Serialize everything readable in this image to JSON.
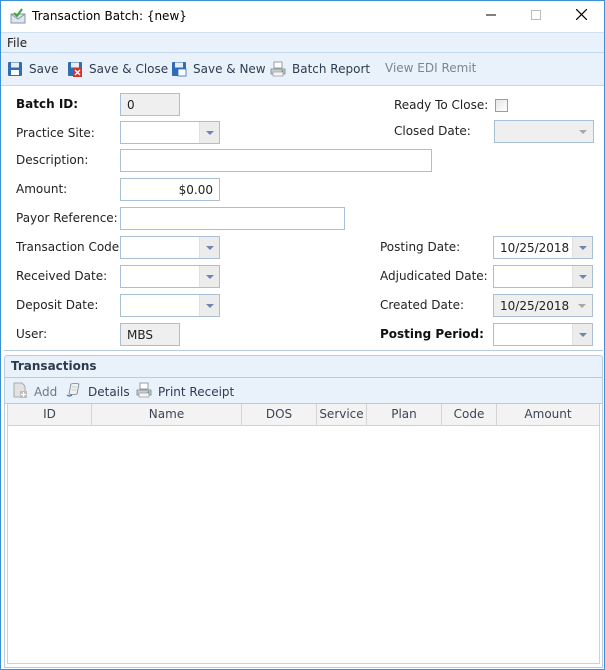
{
  "window": {
    "title": "Transaction Batch: {new}",
    "icon": "envelope-check-icon",
    "controls": {
      "minimize": "minimize-icon",
      "maximize": "maximize-icon",
      "close": "close-icon"
    }
  },
  "menu": {
    "items": [
      {
        "label": "File"
      }
    ]
  },
  "toolbar": {
    "buttons": [
      {
        "label": "Save",
        "icon": "save-icon",
        "enabled": true
      },
      {
        "label": "Save & Close",
        "icon": "save-close-icon",
        "enabled": true
      },
      {
        "label": "Save & New",
        "icon": "save-new-icon",
        "enabled": true
      },
      {
        "label": "Batch Report",
        "icon": "printer-icon",
        "enabled": true
      },
      {
        "label": "View EDI Remit",
        "icon": "",
        "enabled": false
      }
    ]
  },
  "form": {
    "batch_id": {
      "label": "Batch ID:",
      "value": "0"
    },
    "practice_site": {
      "label": "Practice Site:",
      "value": ""
    },
    "description": {
      "label": "Description:",
      "value": ""
    },
    "amount": {
      "label": "Amount:",
      "value": "$0.00"
    },
    "payor_reference": {
      "label": "Payor Reference:",
      "value": ""
    },
    "transaction_code": {
      "label": "Transaction Code:",
      "value": ""
    },
    "received_date": {
      "label": "Received Date:",
      "value": ""
    },
    "deposit_date": {
      "label": "Deposit Date:",
      "value": ""
    },
    "user": {
      "label": "User:",
      "value": "MBS"
    },
    "ready_to_close": {
      "label": "Ready To Close:",
      "checked": false
    },
    "closed_date": {
      "label": "Closed Date:",
      "value": ""
    },
    "posting_date": {
      "label": "Posting Date:",
      "value": "10/25/2018"
    },
    "adjudicated_date": {
      "label": "Adjudicated Date:",
      "value": ""
    },
    "created_date": {
      "label": "Created Date:",
      "value": "10/25/2018"
    },
    "posting_period": {
      "label": "Posting Period:",
      "value": ""
    }
  },
  "transactions": {
    "title": "Transactions",
    "toolbar": [
      {
        "label": "Add",
        "icon": "add-document-icon",
        "enabled": false
      },
      {
        "label": "Details",
        "icon": "scroll-icon",
        "enabled": true
      },
      {
        "label": "Print Receipt",
        "icon": "printer-icon",
        "enabled": true
      }
    ],
    "columns": [
      "ID",
      "Name",
      "DOS",
      "Service",
      "Plan",
      "Code",
      "Amount"
    ],
    "rows": []
  }
}
